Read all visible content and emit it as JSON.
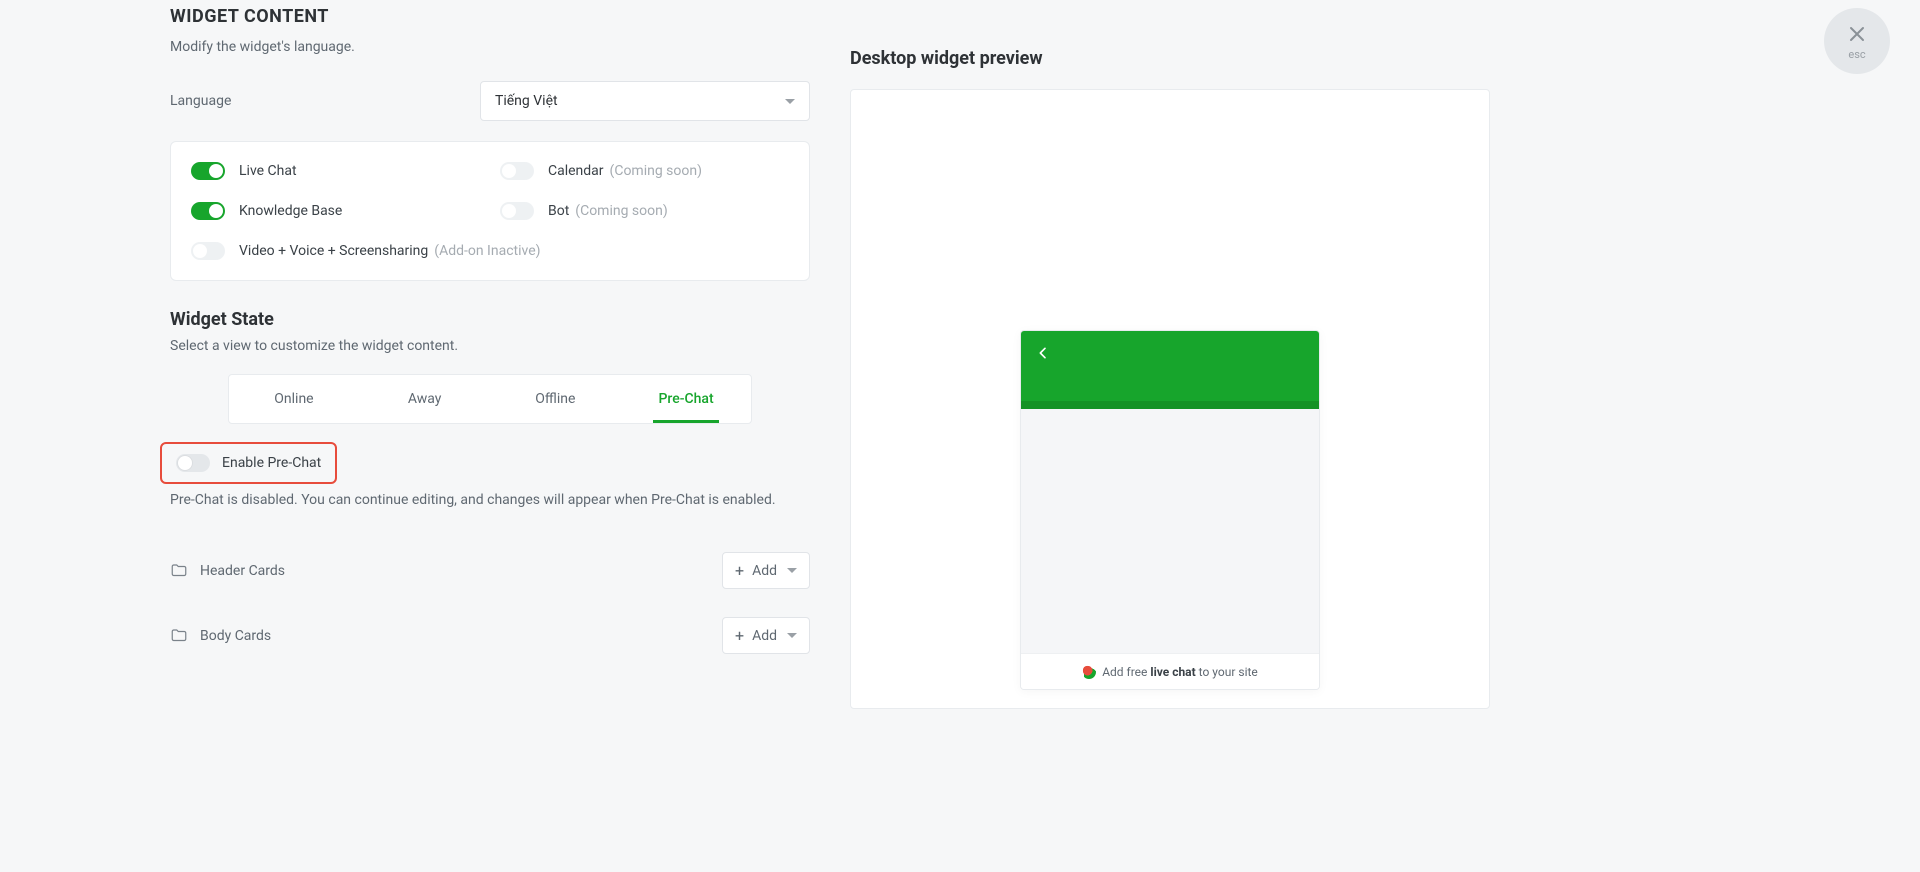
{
  "close": {
    "esc": "esc"
  },
  "header": {
    "title": "WIDGET CONTENT",
    "subtitle": "Modify the widget's language."
  },
  "language": {
    "label": "Language",
    "selected": "Tiếng Việt"
  },
  "features": {
    "liveChat": {
      "label": "Live Chat",
      "on": true
    },
    "calendar": {
      "label": "Calendar",
      "note": "(Coming soon)"
    },
    "kb": {
      "label": "Knowledge Base",
      "on": true
    },
    "bot": {
      "label": "Bot",
      "note": "(Coming soon)"
    },
    "vvs": {
      "label": "Video + Voice + Screensharing",
      "note": "(Add-on Inactive)"
    }
  },
  "widgetState": {
    "title": "Widget State",
    "subtitle": "Select a view to customize the widget content.",
    "tabs": {
      "online": "Online",
      "away": "Away",
      "offline": "Offline",
      "prechat": "Pre-Chat"
    }
  },
  "prechat": {
    "enableLabel": "Enable Pre-Chat",
    "disabledNote": "Pre-Chat is disabled. You can continue editing, and changes will appear when Pre-Chat is enabled."
  },
  "cards": {
    "header": "Header Cards",
    "body": "Body Cards",
    "add": "Add"
  },
  "preview": {
    "title": "Desktop widget preview",
    "footer_prefix": "Add free",
    "footer_bold": "live chat",
    "footer_suffix": "to your site"
  }
}
